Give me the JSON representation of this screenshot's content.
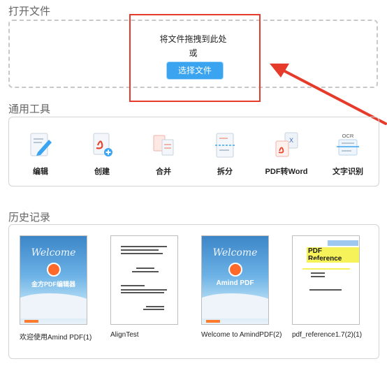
{
  "sections": {
    "open_file": "打开文件",
    "common_tools": "通用工具",
    "history": "历史记录"
  },
  "dropzone": {
    "hint_line1": "将文件拖拽到此处",
    "hint_line2": "或",
    "choose_button": "选择文件"
  },
  "tools": [
    {
      "label": "编辑",
      "icon": "edit-icon"
    },
    {
      "label": "创建",
      "icon": "create-pdf-icon"
    },
    {
      "label": "合并",
      "icon": "merge-icon"
    },
    {
      "label": "拆分",
      "icon": "split-icon"
    },
    {
      "label": "PDF转Word",
      "icon": "pdf-to-word-icon"
    },
    {
      "label": "文字识别",
      "icon": "ocr-icon"
    }
  ],
  "history_items": [
    {
      "name": "欢迎使用Amind PDF(1)"
    },
    {
      "name": "AlignTest"
    },
    {
      "name": "Welcome to AmindPDF(2)"
    },
    {
      "name": "pdf_reference1.7(2)(1)"
    }
  ],
  "thumb_text": {
    "cover1_welcome": "Welcome",
    "cover1_title": "金方PDF编辑器",
    "cover3_welcome": "Welcome",
    "cover3_title": "Amind PDF",
    "ref_title": "PDF Reference"
  },
  "tool_icon_texts": {
    "word_x": "X",
    "ocr": "OCR"
  },
  "colors": {
    "accent": "#3ba4f0",
    "annotation_red": "#e63a2b",
    "pdf_red": "#e8452c"
  }
}
